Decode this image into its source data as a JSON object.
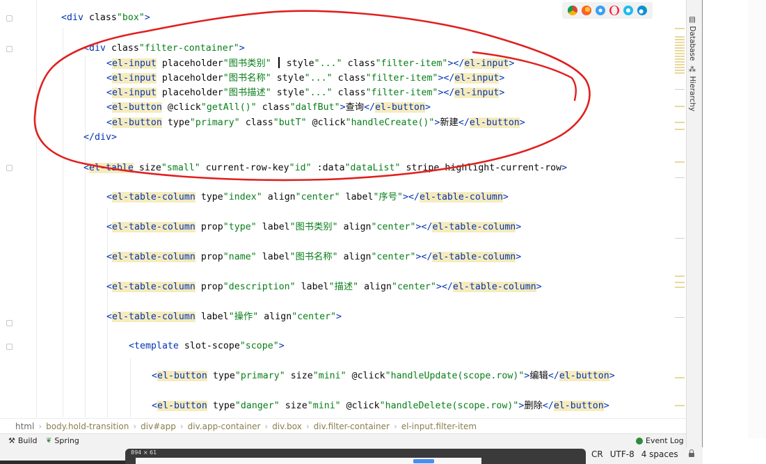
{
  "colors": {
    "tag": "#0033b3",
    "attribute": "#174ad4",
    "string": "#067d17",
    "text": "#080808",
    "match_highlight": "#f6ebbc",
    "annotation": "#e0201e"
  },
  "editor": {
    "lines": [
      "<div class=\"box\">",
      "<div class=\"filter-container\">",
      "<el-input placeholder=\"图书类别\" style=\"...\" class=\"filter-item\"></el-input>",
      "<el-input placeholder=\"图书名称\" style=\"...\" class=\"filter-item\"></el-input>",
      "<el-input placeholder=\"图书描述\" style=\"...\" class=\"filter-item\"></el-input>",
      "<el-button @click=\"getAll()\" class=\"dalfBut\">查询</el-button>",
      "<el-button type=\"primary\" class=\"butT\" @click=\"handleCreate()\">新建</el-button>",
      "</div>",
      "<el-table size=\"small\" current-row-key=\"id\" :data=\"dataList\" stripe highlight-current-row>",
      "<el-table-column type=\"index\" align=\"center\" label=\"序号\"></el-table-column>",
      "<el-table-column prop=\"type\" label=\"图书类别\" align=\"center\"></el-table-column>",
      "<el-table-column prop=\"name\" label=\"图书名称\" align=\"center\"></el-table-column>",
      "<el-table-column prop=\"description\" label=\"描述\" align=\"center\"></el-table-column>",
      "<el-table-column label=\"操作\" align=\"center\">",
      "<template slot-scope=\"scope\">",
      "<el-button type=\"primary\" size=\"mini\" @click=\"handleUpdate(scope.row)\">编辑</el-button>",
      "<el-button type=\"danger\" size=\"mini\" @click=\"handleDelete(scope.row)\">删除</el-button>"
    ]
  },
  "browser_icons": [
    "chrome-icon",
    "firefox-icon",
    "safari-icon",
    "opera-icon",
    "ie-icon",
    "edge-icon"
  ],
  "side_tabs": {
    "database": "Database",
    "hierarchy": "Hierarchy"
  },
  "breadcrumb": [
    "html",
    "body.hold-transition",
    "div#app",
    "div.app-container",
    "div.box",
    "div.filter-container",
    "el-input.filter-item"
  ],
  "tool_windows": {
    "build": "Build",
    "spring": "Spring",
    "event_log": "Event Log"
  },
  "status_bar": {
    "line_separator": "CR",
    "encoding": "UTF-8",
    "indent": "4 spaces",
    "preview_label": "894 × 61"
  }
}
